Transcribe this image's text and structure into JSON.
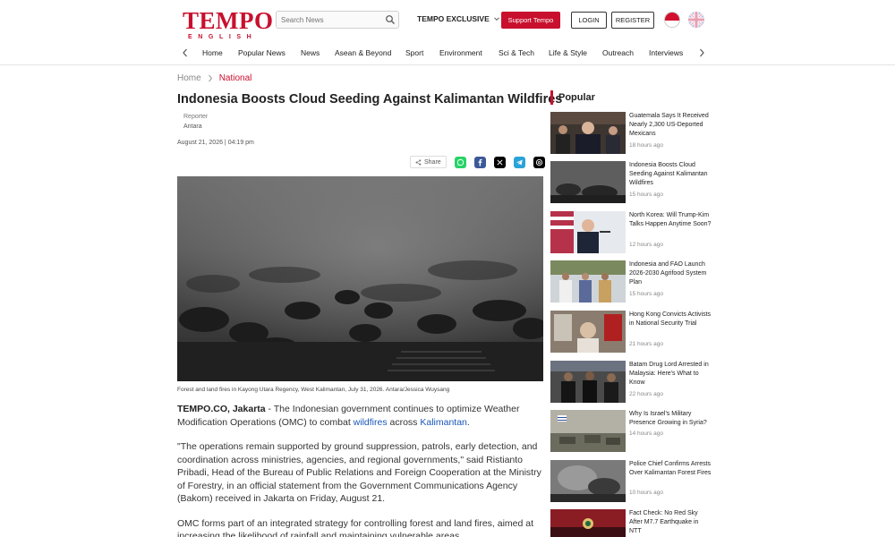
{
  "header": {
    "logo_main": "TEMPO",
    "logo_sub": "ENGLISH",
    "search_placeholder": "Search News",
    "exclusive_label": "TEMPO EXCLUSIVE",
    "support_label": "Support Tempo",
    "login_label": "LOGIN",
    "register_label": "REGISTER",
    "brand_color": "#c8102e"
  },
  "nav": {
    "items": [
      "Home",
      "Popular News",
      "News",
      "Asean & Beyond",
      "Sport",
      "Environment",
      "Sci & Tech",
      "Life & Style",
      "Outreach",
      "Interviews"
    ]
  },
  "breadcrumb": {
    "home": "Home",
    "current": "National"
  },
  "article": {
    "title": "Indonesia Boosts Cloud Seeding Against Kalimantan Wildfires",
    "reporter_label": "Reporter",
    "reporter_name": "Antara",
    "date": "August 21, 2026 | 04:19 pm",
    "share_label": "Share",
    "caption": "Forest and land fires in Kayong Utara Regency, West Kalimantan, July 31, 2026. Antara/Jessica Wuysang",
    "p1_lead": "TEMPO.CO, Jakarta",
    "p1_a": " - The Indonesian government continues to optimize Weather Modification Operations (OMC) to combat ",
    "p1_link1": "wildfires",
    "p1_b": " across ",
    "p1_link2": "Kalimantan",
    "p1_c": ".",
    "p2": "\"The operations remain supported by ground suppression, patrols, early detection, and coordination across ministries, agencies, and regional governments,\" said Ristianto Pribadi, Head of the Bureau of Public Relations and Foreign Cooperation at the Ministry of Forestry, in an official statement from the Government Communications Agency (Bakom) received in Jakarta on Friday, August 21.",
    "p3": "OMC forms part of an integrated strategy for controlling forest and land fires, aimed at increasing the likelihood of rainfall and maintaining vulnerable areas"
  },
  "sidebar": {
    "heading": "Popular",
    "items": [
      {
        "title": "Guatemala Says It Received Nearly 2,300 US-Deported Mexicans",
        "time": "18 hours ago"
      },
      {
        "title": "Indonesia Boosts Cloud Seeding Against Kalimantan Wildfires",
        "time": "15 hours ago"
      },
      {
        "title": "North Korea: Will Trump-Kim Talks Happen Anytime Soon?",
        "time": "12 hours ago"
      },
      {
        "title": "Indonesia and FAO Launch 2026-2030 Agrifood System Plan",
        "time": "15 hours ago"
      },
      {
        "title": "Hong Kong Convicts Activists in National Security Trial",
        "time": "21 hours ago"
      },
      {
        "title": "Batam Drug Lord Arrested in Malaysia: Here's What to Know",
        "time": "22 hours ago"
      },
      {
        "title": "Why Is Israel's Military Presence Growing in Syria?",
        "time": "14 hours ago"
      },
      {
        "title": "Police Chief Confirms Arrests Over Kalimantan Forest Fires",
        "time": "10 hours ago"
      },
      {
        "title": "Fact Check: No Red Sky After M7.7 Earthquake in NTT",
        "time": ""
      }
    ]
  }
}
